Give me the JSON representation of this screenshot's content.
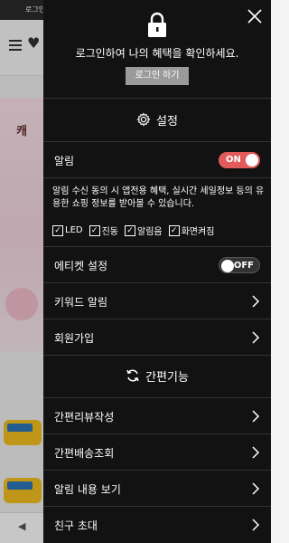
{
  "background": {
    "topbar_text": "로그인",
    "banner_text": "캐"
  },
  "drawer": {
    "login": {
      "message": "로그인하여 나의 혜택을 확인하세요.",
      "button_label": "로그인 하기"
    },
    "settings": {
      "title": "설정",
      "alarm_label": "알림",
      "alarm_toggle": "ON",
      "description": "알림 수신 동의 시 앱전용 혜택, 실시간 세일정보 등의 유용한 쇼핑 정보를 받아볼 수 있습니다.",
      "options": [
        {
          "label": "LED",
          "checked": true
        },
        {
          "label": "진동",
          "checked": true
        },
        {
          "label": "알림음",
          "checked": true
        },
        {
          "label": "화면켜짐",
          "checked": true
        }
      ],
      "etiquette_label": "에티켓 설정",
      "etiquette_toggle": "OFF",
      "keyword_label": "키워드 알림",
      "signup_label": "회원가입"
    },
    "quick": {
      "title": "간편기능",
      "items": [
        "간편리뷰작성",
        "간편배송조회",
        "알림 내용 보기",
        "친구 초대"
      ]
    }
  },
  "colors": {
    "drawer_bg": "#121212",
    "toggle_on": "#e25a5a",
    "login_button": "#9a9a9a"
  }
}
